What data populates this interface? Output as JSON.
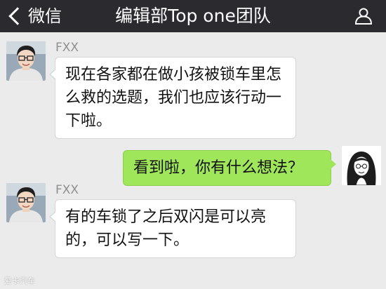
{
  "header": {
    "back_label": "微信",
    "title": "编辑部Top one团队",
    "background": "#2b2a2f"
  },
  "messages": [
    {
      "direction": "incoming",
      "sender": "FXX",
      "avatar": "photo-avatar-man-glasses",
      "text": "现在各家都在做小孩被锁车里怎么救的选题，我们也应该行动一下啦。"
    },
    {
      "direction": "outgoing",
      "avatar": "sketch-avatar-woman",
      "text": "看到啦，你有什么想法？"
    },
    {
      "direction": "incoming",
      "sender": "FXX",
      "avatar": "photo-avatar-man-glasses",
      "text": "有的车锁了之后双闪是可以亮的，可以写一下。"
    }
  ],
  "watermark": "爱卡汽车",
  "colors": {
    "chat_background": "#ebebeb",
    "incoming_bubble": "#ffffff",
    "outgoing_bubble": "#9fe65a",
    "sender_name": "#8f8f8f"
  },
  "icons": {
    "back": "chevron-left-icon",
    "members": "person-icon"
  }
}
